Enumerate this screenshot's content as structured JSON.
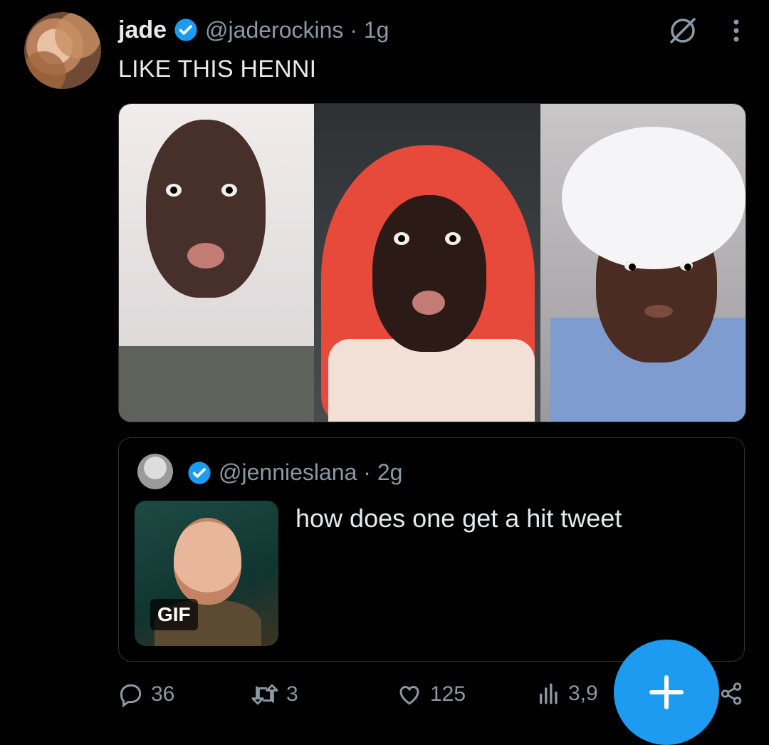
{
  "tweet": {
    "author_name": "jade",
    "author_handle": "@jaderockins · 1g",
    "text": "LIKE THIS HENNI"
  },
  "quoted": {
    "handle": "@jennieslana · 2g",
    "text": "how does one get a hit tweet",
    "gif_badge": "GIF"
  },
  "actions": {
    "replies": "36",
    "retweets": "3",
    "likes": "125",
    "views": "3,9"
  },
  "colors": {
    "background": "#000000",
    "text": "#e7e9ea",
    "muted": "#8b98a5",
    "accent": "#1d9bf0",
    "border": "#2f3336"
  },
  "icons": {
    "verified": "verified-badge-icon",
    "grok": "grok-icon",
    "more": "more-vertical-icon",
    "reply": "reply-icon",
    "retweet": "retweet-icon",
    "like": "heart-icon",
    "views": "views-icon",
    "compose": "plus-icon",
    "share": "share-icon"
  }
}
